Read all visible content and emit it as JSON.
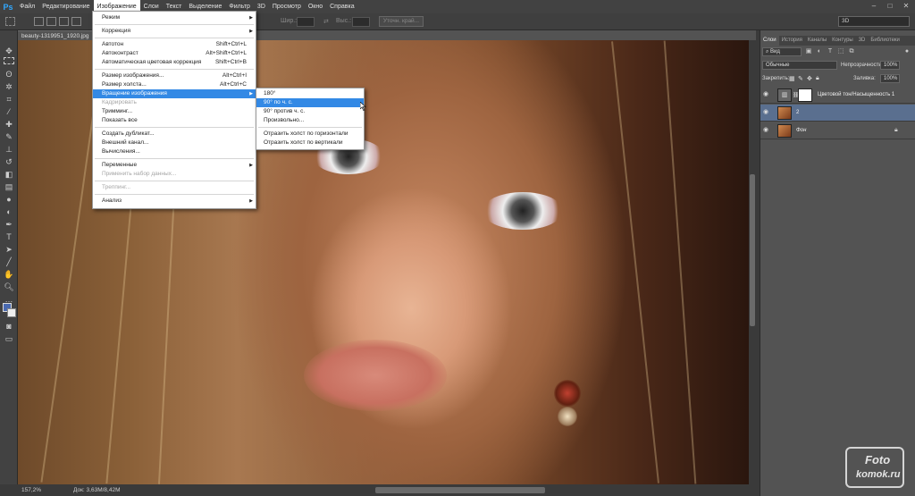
{
  "app": {
    "logo": "Ps"
  },
  "menubar": {
    "items": [
      "Файл",
      "Редактирование",
      "Изображение",
      "Слои",
      "Текст",
      "Выделение",
      "Фильтр",
      "3D",
      "Просмотр",
      "Окно",
      "Справка"
    ]
  },
  "options": {
    "width_label": "Шир.:",
    "height_label": "Выс.:",
    "refine_label": "Уточн. край...",
    "workspace": "3D"
  },
  "document": {
    "tab_title": "beauty-1319951_1920.jpg"
  },
  "status": {
    "zoom": "157,2%",
    "doc_size": "Док: 3,63M/8,42M"
  },
  "image_menu": {
    "mode": "Режим",
    "adjustments": "Коррекция",
    "auto_tone": {
      "label": "Автотон",
      "shortcut": "Shift+Ctrl+L"
    },
    "auto_contrast": {
      "label": "Автоконтраст",
      "shortcut": "Alt+Shift+Ctrl+L"
    },
    "auto_color": {
      "label": "Автоматическая цветовая коррекция",
      "shortcut": "Shift+Ctrl+B"
    },
    "image_size": {
      "label": "Размер изображения...",
      "shortcut": "Alt+Ctrl+I"
    },
    "canvas_size": {
      "label": "Размер холста...",
      "shortcut": "Alt+Ctrl+C"
    },
    "image_rotation": "Вращение изображения",
    "crop": "Кадрировать",
    "trim": "Тримминг...",
    "reveal_all": "Показать все",
    "duplicate": "Создать дубликат...",
    "apply_image": "Внешний канал...",
    "calculations": "Вычисления...",
    "variables": "Переменные",
    "apply_data_set": "Применить набор данных...",
    "trap": "Треппинг...",
    "analysis": "Анализ"
  },
  "rotation_submenu": {
    "rotate_180": "180°",
    "rotate_90_cw": "90° по ч. с.",
    "rotate_90_ccw": "90° против ч. с.",
    "arbitrary": "Произвольно...",
    "flip_horizontal": "Отразить холст по горизонтали",
    "flip_vertical": "Отразить холст по вертикали"
  },
  "layers_panel": {
    "tabs": [
      "Слои",
      "История",
      "Каналы",
      "Контуры",
      "3D",
      "Библиотеки"
    ],
    "kind_filter": "Вид",
    "blend_mode": "Обычные",
    "opacity_label": "Непрозрачность:",
    "opacity_value": "100%",
    "lock_label": "Закрепить:",
    "fill_label": "Заливка:",
    "fill_value": "100%",
    "layers": [
      {
        "name": "Цветовой тон/Насыщенность 1"
      },
      {
        "name": "2"
      },
      {
        "name": "Фон"
      }
    ]
  },
  "watermark": {
    "line1": "Foto",
    "line2": "komok.ru"
  },
  "colors": {
    "highlight": "#3389e5",
    "selected_layer": "#5a6f8f",
    "panel": "#535353"
  }
}
